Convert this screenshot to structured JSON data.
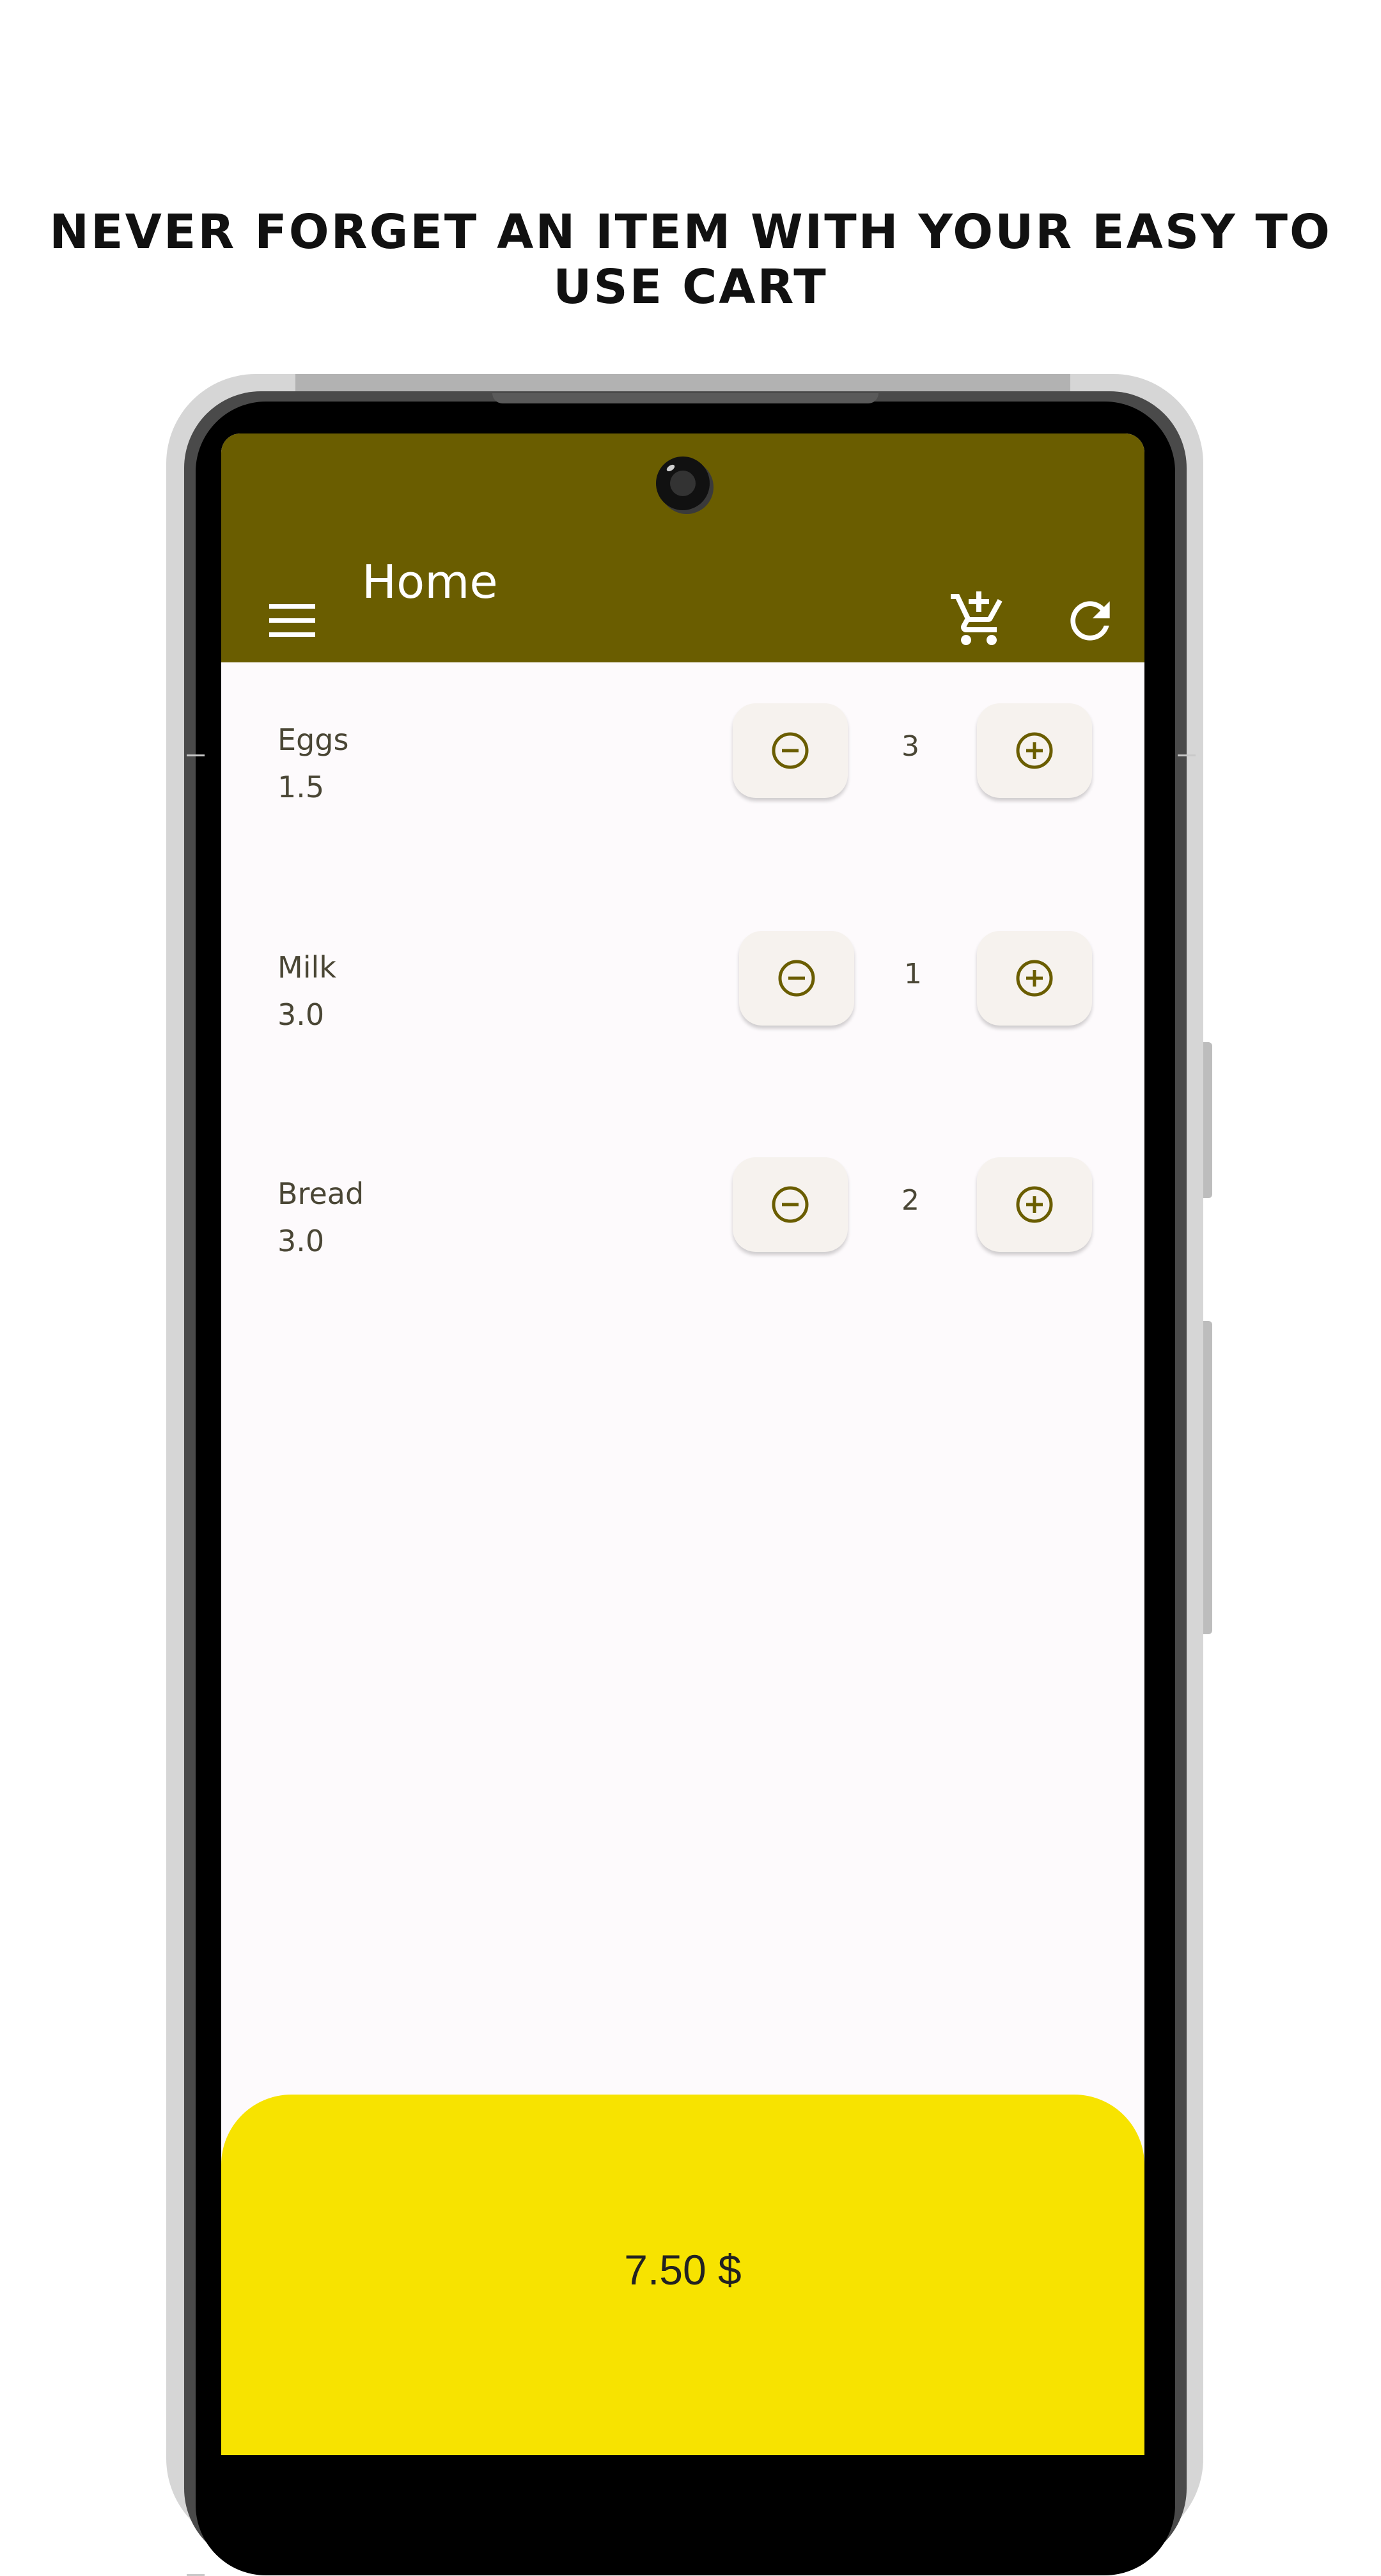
{
  "headline": "NEVER FORGET AN ITEM WITH YOUR EASY TO USE CART",
  "appbar": {
    "title": "Home",
    "icons": [
      "menu-icon",
      "add-shopping-cart-icon",
      "refresh-icon"
    ],
    "color": "#6a5d00"
  },
  "items": [
    {
      "name": "Eggs",
      "price": "1.5",
      "quantity": "3"
    },
    {
      "name": "Milk",
      "price": "3.0",
      "quantity": "1"
    },
    {
      "name": "Bread",
      "price": "3.0",
      "quantity": "2"
    }
  ],
  "total": {
    "label": "7.50 $",
    "color": "#f7e300"
  },
  "colors": {
    "accent": "#6a5d00",
    "background": "#fdfafc",
    "button": "#f6f2ee"
  }
}
